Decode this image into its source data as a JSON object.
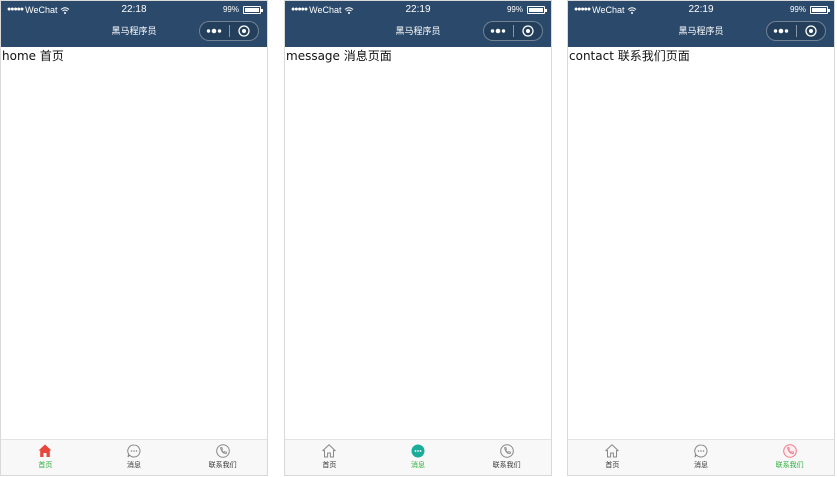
{
  "colors": {
    "navbar_bg": "#2b4a6b",
    "active_label": "#2aae3b",
    "home_active_icon": "#e8463a",
    "message_active_icon": "#1aad9b",
    "contact_active_icon": "#f07a8a",
    "inactive_icon": "#888888"
  },
  "screens": [
    {
      "status": {
        "carrier": "WeChat",
        "time": "22:18",
        "battery": "99%"
      },
      "nav_title": "黑马程序员",
      "content": "home 首页",
      "active_tab": 0,
      "tabs": [
        {
          "label": "首页",
          "icon": "home-icon"
        },
        {
          "label": "消息",
          "icon": "message-icon"
        },
        {
          "label": "联系我们",
          "icon": "phone-icon"
        }
      ]
    },
    {
      "status": {
        "carrier": "WeChat",
        "time": "22:19",
        "battery": "99%"
      },
      "nav_title": "黑马程序员",
      "content": "message 消息页面",
      "active_tab": 1,
      "tabs": [
        {
          "label": "首页",
          "icon": "home-icon"
        },
        {
          "label": "消息",
          "icon": "message-icon"
        },
        {
          "label": "联系我们",
          "icon": "phone-icon"
        }
      ]
    },
    {
      "status": {
        "carrier": "WeChat",
        "time": "22:19",
        "battery": "99%"
      },
      "nav_title": "黑马程序员",
      "content": "contact 联系我们页面",
      "active_tab": 2,
      "tabs": [
        {
          "label": "首页",
          "icon": "home-icon"
        },
        {
          "label": "消息",
          "icon": "message-icon"
        },
        {
          "label": "联系我们",
          "icon": "phone-icon"
        }
      ]
    }
  ]
}
